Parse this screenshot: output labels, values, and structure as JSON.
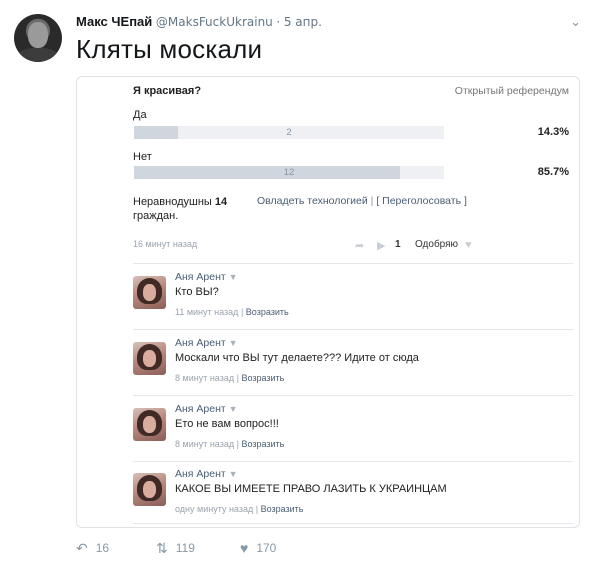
{
  "tweet": {
    "author_name": "Макс ЧЕпай",
    "handle": "@MaksFuckUkrainu",
    "separator": "·",
    "date": "5 апр.",
    "text": "Кляты москали",
    "chevron_icon": "chevron-down-icon",
    "actions": {
      "reply_count": "16",
      "retweet_count": "119",
      "like_count": "170"
    }
  },
  "poll": {
    "question": "Я красивая?",
    "type": "Открытый референдум",
    "options": [
      {
        "label": "Да",
        "count": "2",
        "percent": "14.3%",
        "fraction": 0.143
      },
      {
        "label": "Нет",
        "count": "12",
        "percent": "85.7%",
        "fraction": 0.857
      }
    ],
    "voters_prefix": "Неравнодушны",
    "voters_count": "14",
    "voters_suffix": "граждан.",
    "link_tech": "Овладеть технологией",
    "sep1": "|",
    "link_revote": "[ Переголосовать ]",
    "posted": "16 минут назад",
    "likes": "1",
    "like_label": "Одобряю"
  },
  "comments": [
    {
      "author": "Аня Арент",
      "caret": "▼",
      "text": "Кто ВЫ?",
      "time": "11 минут назад",
      "sep": "|",
      "reply": "Возразить"
    },
    {
      "author": "Аня Арент",
      "caret": "▼",
      "text": "Москали что ВЫ тут делаете??? Идите от сюда",
      "time": "8 минут назад",
      "sep": "|",
      "reply": "Возразить"
    },
    {
      "author": "Аня Арент",
      "caret": "▼",
      "text": "Ето не вам вопрос!!!",
      "time": "8 минут назад",
      "sep": "|",
      "reply": "Возразить"
    },
    {
      "author": "Аня Арент",
      "caret": "▼",
      "text": "КАКОЕ ВЫ ИМЕЕТЕ ПРАВО ЛАЗИТЬ К УКРАИНЦАМ",
      "time": "одну минуту назад",
      "sep": "|",
      "reply": "Возразить"
    }
  ]
}
